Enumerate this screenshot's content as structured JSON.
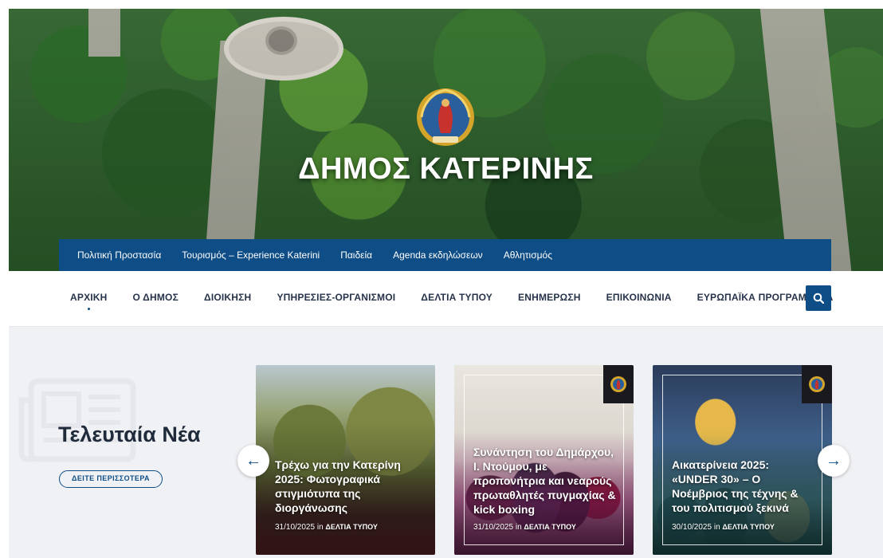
{
  "hero": {
    "title": "ΔΗΜΟΣ ΚΑΤΕΡΙΝΗΣ",
    "emblem_icon": "municipality-emblem"
  },
  "topbar": {
    "links": [
      "Πολιτική Προστασία",
      "Τουρισμός – Experience Katerini",
      "Παιδεία",
      "Agenda εκδηλώσεων",
      "Αθλητισμός"
    ]
  },
  "mainnav": {
    "items": [
      "ΑΡΧΙΚΗ",
      "Ο ΔΗΜΟΣ",
      "ΔΙΟΙΚΗΣΗ",
      "ΥΠΗΡΕΣΙΕΣ-ΟΡΓΑΝΙΣΜΟΙ",
      "ΔΕΛΤΙΑ ΤΥΠΟΥ",
      "ΕΝΗΜΕΡΩΣΗ",
      "ΕΠΙΚΟΙΝΩΝΙΑ",
      "ΕΥΡΩΠΑΪΚΑ ΠΡΟΓΡΑΜΜΑΤΑ"
    ],
    "active_index": 0,
    "search_icon": "search-icon"
  },
  "news": {
    "title": "Τελευταία Νέα",
    "more_label": "ΔΕΙΤΕ ΠΕΡΙΣΣΟΤΕΡΑ",
    "prev_arrow": "←",
    "next_arrow": "→",
    "cards": [
      {
        "headline": "Τρέχω για την Κατερίνη 2025: Φωτογραφικά στιγμιότυπα της διοργάνωσης",
        "date": "31/10/2025",
        "in": "in",
        "category": "ΔΕΛΤΙΑ ΤΥΠΟΥ"
      },
      {
        "headline": "Συνάντηση του Δημάρχου, Ι. Ντούμου, με προπονήτρια και νεαρούς πρωταθλητές πυγμαχίας & kick boxing",
        "date": "31/10/2025",
        "in": "in",
        "category": "ΔΕΛΤΙΑ ΤΥΠΟΥ"
      },
      {
        "headline": "Αικατερίνεια 2025: «UNDER 30» – Ο Νοέμβριος  της τέχνης & του πολιτισμού ξεκινά",
        "date": "30/10/2025",
        "in": "in",
        "category": "ΔΕΛΤΙΑ ΤΥΠΟΥ"
      }
    ]
  },
  "colors": {
    "brand_blue": "#0e4d86",
    "nav_text": "#27334a",
    "section_bg": "#f0f1f4"
  }
}
